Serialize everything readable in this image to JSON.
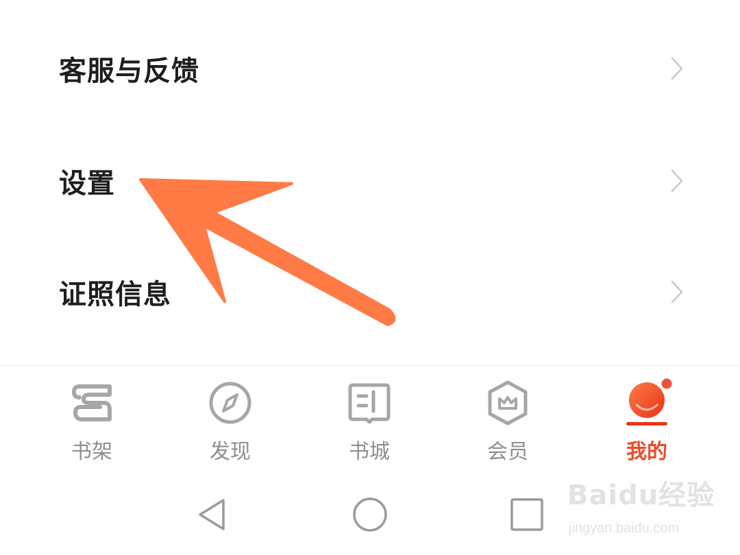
{
  "menu": {
    "items": [
      {
        "label": "客服与反馈"
      },
      {
        "label": "设置"
      },
      {
        "label": "证照信息"
      }
    ]
  },
  "tabbar": {
    "tabs": [
      {
        "label": "书架",
        "icon": "bookshelf-icon",
        "active": false
      },
      {
        "label": "发现",
        "icon": "compass-icon",
        "active": false
      },
      {
        "label": "书城",
        "icon": "book-store-icon",
        "active": false
      },
      {
        "label": "会员",
        "icon": "vip-crown-icon",
        "active": false
      },
      {
        "label": "我的",
        "icon": "profile-icon",
        "active": true,
        "badge": true
      }
    ]
  },
  "sysnav": {
    "buttons": [
      "back-icon",
      "home-icon",
      "recents-icon"
    ]
  },
  "watermark": {
    "brand": "Baidu经验",
    "url": "jingyan.baidu.com"
  },
  "colors": {
    "accent": "#f04a27",
    "arrow": "#ff7a45",
    "inactive": "#8e8e8e",
    "text": "#1e1e1e"
  }
}
